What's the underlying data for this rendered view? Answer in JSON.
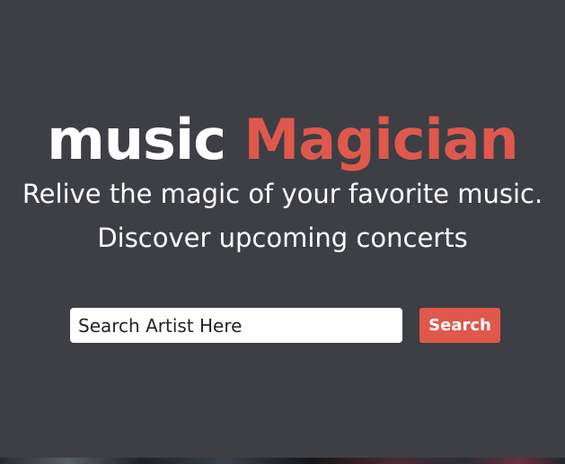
{
  "hero": {
    "title_part1": "music",
    "title_part2": "Magician",
    "tagline_line1": "Relive the magic of your favorite music.",
    "tagline_line2": "Discover upcoming concerts"
  },
  "search": {
    "placeholder": "Search Artist Here",
    "value": "",
    "button_label": "Search"
  },
  "colors": {
    "background": "#3d3f45",
    "accent": "#e0584c",
    "text": "#ffffff"
  }
}
